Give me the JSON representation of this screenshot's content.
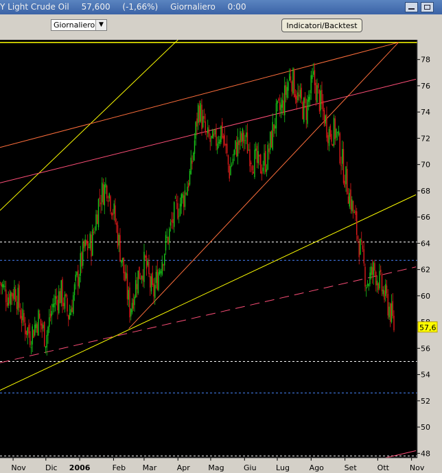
{
  "header": {
    "instrument": "Y Light Crude Oil",
    "price": "57,600",
    "change": "(-1,66%)",
    "period": "Giornaliero",
    "time": "0:00"
  },
  "toolbar": {
    "period_select": "Giornaliero",
    "indicators_button": "Indicatori/Backtest"
  },
  "colors": {
    "background": "#000000",
    "up_candle": "#19c819",
    "down_candle": "#e01b1b",
    "axis_text": "#ffff00",
    "price_tag": "#ffff00"
  },
  "chart_data": {
    "type": "candlestick",
    "instrument": "Light Crude Oil",
    "last_price": 57.6,
    "last_price_label": "57,6",
    "y_range": [
      46.5,
      79.5
    ],
    "y_ticks": [
      48,
      50,
      52,
      54,
      56,
      58,
      60,
      62,
      64,
      66,
      68,
      70,
      72,
      74,
      76,
      78
    ],
    "x_labels": [
      "Nov",
      "Dic",
      "2006",
      "Feb",
      "Mar",
      "Apr",
      "Mag",
      "Giu",
      "Lug",
      "Ago",
      "Set",
      "Ott",
      "Nov"
    ],
    "price_path": [
      [
        "2005-10-20",
        61.0
      ],
      [
        "2005-10-27",
        60.0
      ],
      [
        "2005-11-03",
        60.5
      ],
      [
        "2005-11-10",
        58.0
      ],
      [
        "2005-11-17",
        57.0
      ],
      [
        "2005-11-24",
        58.3
      ],
      [
        "2005-12-01",
        56.8
      ],
      [
        "2005-12-08",
        59.5
      ],
      [
        "2005-12-15",
        60.2
      ],
      [
        "2005-12-22",
        58.5
      ],
      [
        "2005-12-29",
        61.0
      ],
      [
        "2006-01-05",
        63.5
      ],
      [
        "2006-01-12",
        64.0
      ],
      [
        "2006-01-19",
        67.5
      ],
      [
        "2006-01-26",
        68.5
      ],
      [
        "2006-02-02",
        66.0
      ],
      [
        "2006-02-09",
        62.5
      ],
      [
        "2006-02-16",
        59.0
      ],
      [
        "2006-02-23",
        61.5
      ],
      [
        "2006-03-02",
        62.5
      ],
      [
        "2006-03-09",
        60.0
      ],
      [
        "2006-03-16",
        62.5
      ],
      [
        "2006-03-23",
        64.5
      ],
      [
        "2006-03-30",
        66.5
      ],
      [
        "2006-04-06",
        67.5
      ],
      [
        "2006-04-13",
        69.5
      ],
      [
        "2006-04-20",
        74.5
      ],
      [
        "2006-04-27",
        72.0
      ],
      [
        "2006-05-04",
        71.5
      ],
      [
        "2006-05-11",
        72.8
      ],
      [
        "2006-05-18",
        69.5
      ],
      [
        "2006-05-25",
        71.5
      ],
      [
        "2006-06-01",
        72.0
      ],
      [
        "2006-06-08",
        70.5
      ],
      [
        "2006-06-15",
        69.8
      ],
      [
        "2006-06-22",
        70.5
      ],
      [
        "2006-06-29",
        73.5
      ],
      [
        "2006-07-06",
        74.5
      ],
      [
        "2006-07-13",
        77.0
      ],
      [
        "2006-07-20",
        75.0
      ],
      [
        "2006-07-27",
        74.0
      ],
      [
        "2006-08-03",
        76.5
      ],
      [
        "2006-08-10",
        74.5
      ],
      [
        "2006-08-17",
        72.5
      ],
      [
        "2006-08-24",
        72.5
      ],
      [
        "2006-08-31",
        69.5
      ],
      [
        "2006-09-07",
        67.0
      ],
      [
        "2006-09-14",
        64.0
      ],
      [
        "2006-09-21",
        61.0
      ],
      [
        "2006-09-28",
        62.0
      ],
      [
        "2006-10-05",
        60.5
      ],
      [
        "2006-10-12",
        59.0
      ],
      [
        "2006-10-16",
        57.6
      ]
    ],
    "trendlines": [
      {
        "color": "#ffff00",
        "from": [
          "2005-10-20",
          66.5
        ],
        "to": [
          "2006-04-01",
          79.5
        ]
      },
      {
        "color": "#ff6f3c",
        "from": [
          "2005-10-20",
          71.3
        ],
        "to": [
          "2006-10-20",
          79.3
        ]
      },
      {
        "color": "#ff4f79",
        "from": [
          "2005-10-20",
          68.6
        ],
        "to": [
          "2006-11-05",
          76.5
        ]
      },
      {
        "color": "#ff6f3c",
        "from": [
          "2006-02-15",
          57.5
        ],
        "to": [
          "2006-10-20",
          79.3
        ]
      },
      {
        "color": "#ffff00",
        "from": [
          "2005-10-20",
          52.8
        ],
        "to": [
          "2006-11-05",
          67.7
        ]
      },
      {
        "color": "#ff4f79",
        "from": [
          "2005-10-20",
          54.9
        ],
        "to": [
          "2006-11-05",
          62.2
        ],
        "dashed": true
      },
      {
        "color": "#ff4f79",
        "from": [
          "2006-08-10",
          46.5
        ],
        "to": [
          "2006-11-05",
          48.2
        ]
      }
    ],
    "horizontal_levels": [
      {
        "value": 64.1,
        "color": "#ffffff"
      },
      {
        "value": 62.7,
        "color": "#4a86ff"
      },
      {
        "value": 55.0,
        "color": "#ffffff"
      },
      {
        "value": 52.6,
        "color": "#4a86ff"
      },
      {
        "value": 47.8,
        "color": "#ffffff"
      },
      {
        "value": 79.3,
        "color": "#ffff00",
        "solid": true
      }
    ]
  }
}
